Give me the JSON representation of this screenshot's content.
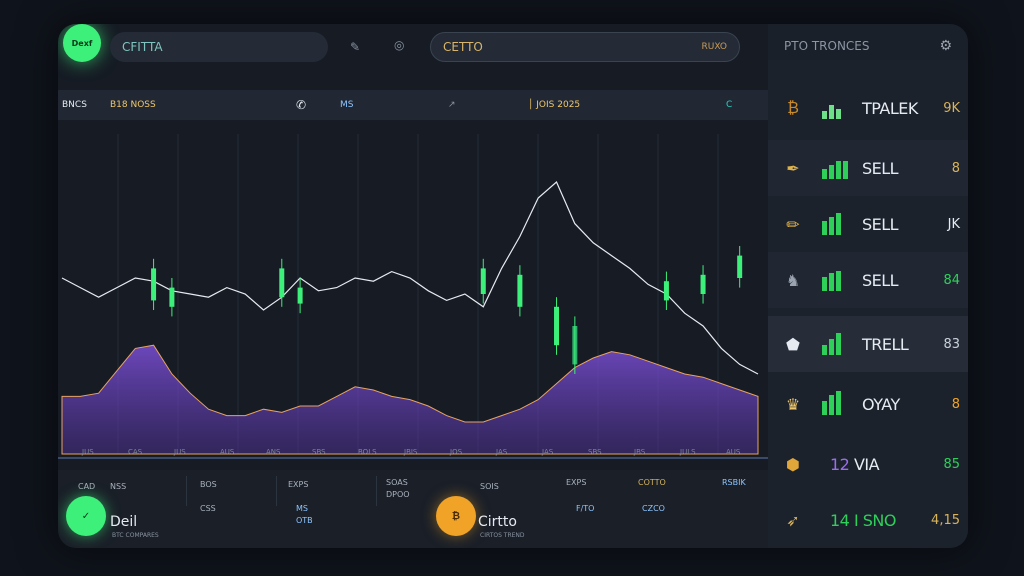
{
  "header": {
    "logo_text": "Dexf",
    "search_left": "CFITTA",
    "search_right": "CETTO",
    "search_right_tag": "RUXO",
    "panel_title": "PTO TRONCES"
  },
  "ticker": {
    "label": "BNCS",
    "items": [
      "B18 NOSS",
      "MS",
      "JOIS 2025",
      "C"
    ]
  },
  "axis_labels": [
    "JUS",
    "CAS",
    "JUS",
    "AUS",
    "ANS",
    "SBS",
    "BOLS",
    "JBIS",
    "JOS",
    "JAS",
    "JAS",
    "SBS",
    "JBS",
    "JULS",
    "AUS"
  ],
  "panel_rows": [
    {
      "label": "TPALEK",
      "value": "9K",
      "icon": "bitcoin-icon",
      "style": "normal"
    },
    {
      "label": "SELL",
      "value": "8",
      "icon": "pen-icon",
      "style": "alt"
    },
    {
      "label": "SELL",
      "value": "JK",
      "icon": "pen-icon",
      "style": "normal"
    },
    {
      "label": "SELL",
      "value": "84",
      "icon": "figure-icon",
      "style": "alt"
    },
    {
      "label": "TRELL",
      "value": "83",
      "icon": "shield-icon",
      "style": "alt"
    },
    {
      "label": "OYAY",
      "value": "8",
      "icon": "crown-icon",
      "style": "normal"
    },
    {
      "label": "VIA",
      "value": "85",
      "icon": "hexagon-icon",
      "style": "normal"
    },
    {
      "label": "14 I SNO",
      "value": "4,15",
      "icon": "rocket-icon",
      "style": "normal"
    }
  ],
  "row7_prefix": "12",
  "bottom": {
    "col_headers": [
      "CAD",
      "BOS",
      "EXPS",
      "SOAS",
      "SOIS",
      "EXPS",
      "COTTO",
      "RSBIK"
    ],
    "col_sub": [
      "NSS",
      "CSS",
      "MS",
      "OTB",
      "DPOO",
      "F/TO",
      "CZCO"
    ],
    "coin1": {
      "name": "Deil",
      "sub": "BTC COMPARES"
    },
    "coin2": {
      "name": "Cirtto",
      "sub": "CIRTOS TREND"
    }
  },
  "colors": {
    "accent_green": "#3df07a",
    "accent_orange": "#f0a326",
    "purple": "#7b4fd6",
    "gold": "#d7b35c"
  },
  "chart_data": {
    "type": "line",
    "series": [
      {
        "values": [
          0.55,
          0.52,
          0.49,
          0.52,
          0.55,
          0.54,
          0.51,
          0.5,
          0.49,
          0.52,
          0.5,
          0.45,
          0.49,
          0.55,
          0.51,
          0.52,
          0.55,
          0.54,
          0.57,
          0.55,
          0.51,
          0.48,
          0.5,
          0.46,
          0.58,
          0.68,
          0.8,
          0.85,
          0.72,
          0.66,
          0.62,
          0.58,
          0.53,
          0.5,
          0.44,
          0.4,
          0.33,
          0.28,
          0.25
        ]
      },
      {
        "values": [
          0.18,
          0.18,
          0.19,
          0.26,
          0.33,
          0.34,
          0.25,
          0.19,
          0.14,
          0.12,
          0.12,
          0.14,
          0.13,
          0.15,
          0.15,
          0.18,
          0.21,
          0.2,
          0.18,
          0.17,
          0.15,
          0.12,
          0.1,
          0.1,
          0.12,
          0.14,
          0.17,
          0.22,
          0.27,
          0.3,
          0.32,
          0.31,
          0.29,
          0.27,
          0.25,
          0.24,
          0.22,
          0.2,
          0.18
        ]
      }
    ],
    "candles": [
      {
        "i": 5,
        "open": 0.48,
        "close": 0.58,
        "dir": "up"
      },
      {
        "i": 6,
        "open": 0.46,
        "close": 0.52,
        "dir": "up"
      },
      {
        "i": 12,
        "open": 0.49,
        "close": 0.58,
        "dir": "up"
      },
      {
        "i": 13,
        "open": 0.47,
        "close": 0.52,
        "dir": "up"
      },
      {
        "i": 23,
        "open": 0.5,
        "close": 0.58,
        "dir": "up"
      },
      {
        "i": 25,
        "open": 0.46,
        "close": 0.56,
        "dir": "up"
      },
      {
        "i": 27,
        "open": 0.34,
        "close": 0.46,
        "dir": "up"
      },
      {
        "i": 28,
        "open": 0.28,
        "close": 0.4,
        "dir": "down"
      },
      {
        "i": 33,
        "open": 0.48,
        "close": 0.54,
        "dir": "up"
      },
      {
        "i": 35,
        "open": 0.5,
        "close": 0.56,
        "dir": "up"
      },
      {
        "i": 37,
        "open": 0.55,
        "close": 0.62,
        "dir": "up"
      }
    ]
  }
}
